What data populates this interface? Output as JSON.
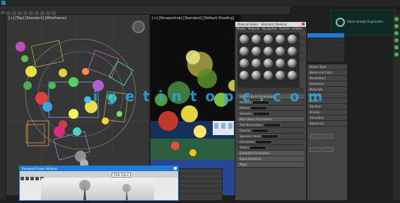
{
  "watermark": "igetintopc.com",
  "menubar": {
    "items": [
      "",
      "",
      "",
      "",
      "",
      "",
      "",
      "",
      "",
      "",
      ""
    ]
  },
  "viewport_left": {
    "label": "[+] [Top] [Standard] [Wireframe]"
  },
  "viewport_right": {
    "label": "[+] [Perspective] [Standard] [Default Shading]"
  },
  "material_editor": {
    "title": "Material Editor - Standard_Material",
    "menu": [
      "Modes",
      "Material",
      "Navigation",
      "Options",
      "Utilities"
    ],
    "rollouts": [
      "Shader Basic Parameters",
      "Blinn Basic Parameters",
      "Extended Parameters",
      "SuperSampling",
      "Maps"
    ],
    "params": [
      {
        "label": "Ambient",
        "value": ""
      },
      {
        "label": "Diffuse",
        "value": ""
      },
      {
        "label": "Specular",
        "value": ""
      },
      {
        "label": "Self-Illumination",
        "value": "0"
      },
      {
        "label": "Opacity",
        "value": "100"
      },
      {
        "label": "Specular Level",
        "value": "0"
      },
      {
        "label": "Glossiness",
        "value": "10"
      },
      {
        "label": "Soften",
        "value": "0.1"
      }
    ]
  },
  "render_window": {
    "title": "Rendered Frame Window",
    "toolbar_value": "RGB Alpha",
    "channels": [
      "",
      "",
      ""
    ]
  },
  "render_setup": {
    "rows": [
      "",
      "",
      "",
      "",
      ""
    ]
  },
  "start_panel": {
    "title": "Some Sample Exploration"
  },
  "command_panel": {
    "tree_items": [
      "Object Type",
      "Name and Color",
      "Parameters",
      "Geometry",
      "Materials",
      "Surface",
      "Scene",
      "Random",
      "Display",
      "Animation",
      "Advanced"
    ],
    "list_items": [
      "",
      "",
      "",
      "",
      "",
      ""
    ]
  },
  "colors": {
    "accent": "#1e7bd6",
    "viewport_bg": "#363636",
    "panel_bg": "#444444",
    "watermark": "#2aa8e0"
  }
}
